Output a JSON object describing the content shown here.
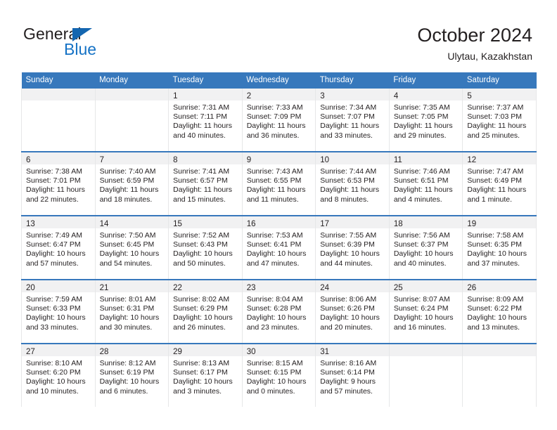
{
  "brand": {
    "name_part1": "General",
    "name_part2": "Blue",
    "triangle_icon": "triangle-icon",
    "accent_color": "#1572c5"
  },
  "header": {
    "title": "October 2024",
    "location": "Ulytau, Kazakhstan"
  },
  "theme": {
    "header_band": "#3778bc",
    "daynum_band": "#f1f1f2",
    "text": "#231f20",
    "cell_divider": "#e6e7e8"
  },
  "weekday_headers": [
    "Sunday",
    "Monday",
    "Tuesday",
    "Wednesday",
    "Thursday",
    "Friday",
    "Saturday"
  ],
  "weeks": [
    [
      {
        "day": "",
        "sunrise": "",
        "sunset": "",
        "daylight1": "",
        "daylight2": ""
      },
      {
        "day": "",
        "sunrise": "",
        "sunset": "",
        "daylight1": "",
        "daylight2": ""
      },
      {
        "day": "1",
        "sunrise": "Sunrise: 7:31 AM",
        "sunset": "Sunset: 7:11 PM",
        "daylight1": "Daylight: 11 hours",
        "daylight2": "and 40 minutes."
      },
      {
        "day": "2",
        "sunrise": "Sunrise: 7:33 AM",
        "sunset": "Sunset: 7:09 PM",
        "daylight1": "Daylight: 11 hours",
        "daylight2": "and 36 minutes."
      },
      {
        "day": "3",
        "sunrise": "Sunrise: 7:34 AM",
        "sunset": "Sunset: 7:07 PM",
        "daylight1": "Daylight: 11 hours",
        "daylight2": "and 33 minutes."
      },
      {
        "day": "4",
        "sunrise": "Sunrise: 7:35 AM",
        "sunset": "Sunset: 7:05 PM",
        "daylight1": "Daylight: 11 hours",
        "daylight2": "and 29 minutes."
      },
      {
        "day": "5",
        "sunrise": "Sunrise: 7:37 AM",
        "sunset": "Sunset: 7:03 PM",
        "daylight1": "Daylight: 11 hours",
        "daylight2": "and 25 minutes."
      }
    ],
    [
      {
        "day": "6",
        "sunrise": "Sunrise: 7:38 AM",
        "sunset": "Sunset: 7:01 PM",
        "daylight1": "Daylight: 11 hours",
        "daylight2": "and 22 minutes."
      },
      {
        "day": "7",
        "sunrise": "Sunrise: 7:40 AM",
        "sunset": "Sunset: 6:59 PM",
        "daylight1": "Daylight: 11 hours",
        "daylight2": "and 18 minutes."
      },
      {
        "day": "8",
        "sunrise": "Sunrise: 7:41 AM",
        "sunset": "Sunset: 6:57 PM",
        "daylight1": "Daylight: 11 hours",
        "daylight2": "and 15 minutes."
      },
      {
        "day": "9",
        "sunrise": "Sunrise: 7:43 AM",
        "sunset": "Sunset: 6:55 PM",
        "daylight1": "Daylight: 11 hours",
        "daylight2": "and 11 minutes."
      },
      {
        "day": "10",
        "sunrise": "Sunrise: 7:44 AM",
        "sunset": "Sunset: 6:53 PM",
        "daylight1": "Daylight: 11 hours",
        "daylight2": "and 8 minutes."
      },
      {
        "day": "11",
        "sunrise": "Sunrise: 7:46 AM",
        "sunset": "Sunset: 6:51 PM",
        "daylight1": "Daylight: 11 hours",
        "daylight2": "and 4 minutes."
      },
      {
        "day": "12",
        "sunrise": "Sunrise: 7:47 AM",
        "sunset": "Sunset: 6:49 PM",
        "daylight1": "Daylight: 11 hours",
        "daylight2": "and 1 minute."
      }
    ],
    [
      {
        "day": "13",
        "sunrise": "Sunrise: 7:49 AM",
        "sunset": "Sunset: 6:47 PM",
        "daylight1": "Daylight: 10 hours",
        "daylight2": "and 57 minutes."
      },
      {
        "day": "14",
        "sunrise": "Sunrise: 7:50 AM",
        "sunset": "Sunset: 6:45 PM",
        "daylight1": "Daylight: 10 hours",
        "daylight2": "and 54 minutes."
      },
      {
        "day": "15",
        "sunrise": "Sunrise: 7:52 AM",
        "sunset": "Sunset: 6:43 PM",
        "daylight1": "Daylight: 10 hours",
        "daylight2": "and 50 minutes."
      },
      {
        "day": "16",
        "sunrise": "Sunrise: 7:53 AM",
        "sunset": "Sunset: 6:41 PM",
        "daylight1": "Daylight: 10 hours",
        "daylight2": "and 47 minutes."
      },
      {
        "day": "17",
        "sunrise": "Sunrise: 7:55 AM",
        "sunset": "Sunset: 6:39 PM",
        "daylight1": "Daylight: 10 hours",
        "daylight2": "and 44 minutes."
      },
      {
        "day": "18",
        "sunrise": "Sunrise: 7:56 AM",
        "sunset": "Sunset: 6:37 PM",
        "daylight1": "Daylight: 10 hours",
        "daylight2": "and 40 minutes."
      },
      {
        "day": "19",
        "sunrise": "Sunrise: 7:58 AM",
        "sunset": "Sunset: 6:35 PM",
        "daylight1": "Daylight: 10 hours",
        "daylight2": "and 37 minutes."
      }
    ],
    [
      {
        "day": "20",
        "sunrise": "Sunrise: 7:59 AM",
        "sunset": "Sunset: 6:33 PM",
        "daylight1": "Daylight: 10 hours",
        "daylight2": "and 33 minutes."
      },
      {
        "day": "21",
        "sunrise": "Sunrise: 8:01 AM",
        "sunset": "Sunset: 6:31 PM",
        "daylight1": "Daylight: 10 hours",
        "daylight2": "and 30 minutes."
      },
      {
        "day": "22",
        "sunrise": "Sunrise: 8:02 AM",
        "sunset": "Sunset: 6:29 PM",
        "daylight1": "Daylight: 10 hours",
        "daylight2": "and 26 minutes."
      },
      {
        "day": "23",
        "sunrise": "Sunrise: 8:04 AM",
        "sunset": "Sunset: 6:28 PM",
        "daylight1": "Daylight: 10 hours",
        "daylight2": "and 23 minutes."
      },
      {
        "day": "24",
        "sunrise": "Sunrise: 8:06 AM",
        "sunset": "Sunset: 6:26 PM",
        "daylight1": "Daylight: 10 hours",
        "daylight2": "and 20 minutes."
      },
      {
        "day": "25",
        "sunrise": "Sunrise: 8:07 AM",
        "sunset": "Sunset: 6:24 PM",
        "daylight1": "Daylight: 10 hours",
        "daylight2": "and 16 minutes."
      },
      {
        "day": "26",
        "sunrise": "Sunrise: 8:09 AM",
        "sunset": "Sunset: 6:22 PM",
        "daylight1": "Daylight: 10 hours",
        "daylight2": "and 13 minutes."
      }
    ],
    [
      {
        "day": "27",
        "sunrise": "Sunrise: 8:10 AM",
        "sunset": "Sunset: 6:20 PM",
        "daylight1": "Daylight: 10 hours",
        "daylight2": "and 10 minutes."
      },
      {
        "day": "28",
        "sunrise": "Sunrise: 8:12 AM",
        "sunset": "Sunset: 6:19 PM",
        "daylight1": "Daylight: 10 hours",
        "daylight2": "and 6 minutes."
      },
      {
        "day": "29",
        "sunrise": "Sunrise: 8:13 AM",
        "sunset": "Sunset: 6:17 PM",
        "daylight1": "Daylight: 10 hours",
        "daylight2": "and 3 minutes."
      },
      {
        "day": "30",
        "sunrise": "Sunrise: 8:15 AM",
        "sunset": "Sunset: 6:15 PM",
        "daylight1": "Daylight: 10 hours",
        "daylight2": "and 0 minutes."
      },
      {
        "day": "31",
        "sunrise": "Sunrise: 8:16 AM",
        "sunset": "Sunset: 6:14 PM",
        "daylight1": "Daylight: 9 hours",
        "daylight2": "and 57 minutes."
      },
      {
        "day": "",
        "sunrise": "",
        "sunset": "",
        "daylight1": "",
        "daylight2": ""
      },
      {
        "day": "",
        "sunrise": "",
        "sunset": "",
        "daylight1": "",
        "daylight2": ""
      }
    ]
  ]
}
